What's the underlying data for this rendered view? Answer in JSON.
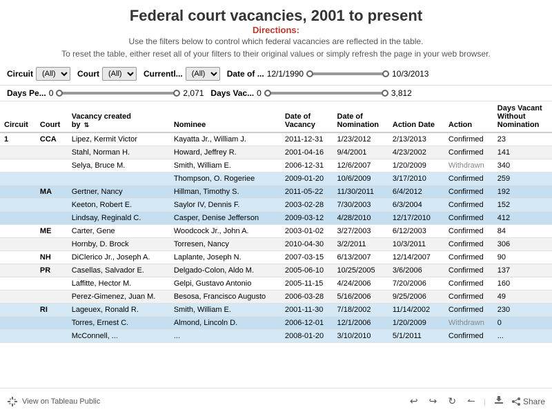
{
  "title": "Federal court vacancies, 2001 to present",
  "directions": {
    "label": "Directions:",
    "line1": "Use the filters below to control which federal vacancies are reflected in the table.",
    "line2": "To reset the table, either reset all of your filters to their original values or simply refresh the page in your web browser."
  },
  "filters": {
    "circuit_label": "Circuit",
    "circuit_value": "(All)",
    "court_label": "Court",
    "court_value": "(All)",
    "currently_label": "Currentl...",
    "currently_value": "(All)",
    "date_label": "Date of ...",
    "date_min": "12/1/1990",
    "date_max": "10/3/2013",
    "days_pending_label": "Days Pe...",
    "days_pending_min": "0",
    "days_pending_max": "2,071",
    "days_vacant_label": "Days Vac...",
    "days_vacant_min": "0",
    "days_vacant_max": "3,812"
  },
  "table": {
    "columns": [
      {
        "id": "circuit",
        "label": "Circuit"
      },
      {
        "id": "court",
        "label": "Court"
      },
      {
        "id": "vacancy_created_by",
        "label": "Vacancy created by"
      },
      {
        "id": "nominee",
        "label": "Nominee"
      },
      {
        "id": "date_of_vacancy",
        "label": "Date of Vacancy"
      },
      {
        "id": "date_of_nomination",
        "label": "Date of Nomination"
      },
      {
        "id": "action_date",
        "label": "Action Date"
      },
      {
        "id": "action",
        "label": "Action"
      },
      {
        "id": "days_vacant",
        "label": "Days Vacant Without Nomination"
      }
    ],
    "rows": [
      {
        "circuit": "1",
        "court": "CCA",
        "vacancy_created_by": "Lipez, Kermit Victor",
        "nominee": "Kayatta Jr., William J.",
        "date_of_vacancy": "2011-12-31",
        "date_of_nomination": "1/23/2012",
        "action_date": "2/13/2013",
        "action": "Confirmed",
        "days_vacant": "23",
        "style": "normal"
      },
      {
        "circuit": "",
        "court": "",
        "vacancy_created_by": "Stahl, Norman H.",
        "nominee": "Howard, Jeffrey R.",
        "date_of_vacancy": "2001-04-16",
        "date_of_nomination": "9/4/2001",
        "action_date": "4/23/2002",
        "action": "Confirmed",
        "days_vacant": "141",
        "style": "alt"
      },
      {
        "circuit": "",
        "court": "",
        "vacancy_created_by": "Selya, Bruce M.",
        "nominee": "Smith, William E.",
        "date_of_vacancy": "2006-12-31",
        "date_of_nomination": "12/6/2007",
        "action_date": "1/20/2009",
        "action": "Withdrawn",
        "days_vacant": "340",
        "style": "normal"
      },
      {
        "circuit": "",
        "court": "",
        "vacancy_created_by": "",
        "nominee": "Thompson, O. Rogeriee",
        "date_of_vacancy": "2009-01-20",
        "date_of_nomination": "10/6/2009",
        "action_date": "3/17/2010",
        "action": "Confirmed",
        "days_vacant": "259",
        "style": "blue"
      },
      {
        "circuit": "",
        "court": "MA",
        "vacancy_created_by": "Gertner, Nancy",
        "nominee": "Hillman, Timothy S.",
        "date_of_vacancy": "2011-05-22",
        "date_of_nomination": "11/30/2011",
        "action_date": "6/4/2012",
        "action": "Confirmed",
        "days_vacant": "192",
        "style": "blue-alt"
      },
      {
        "circuit": "",
        "court": "",
        "vacancy_created_by": "Keeton, Robert E.",
        "nominee": "Saylor IV, Dennis F.",
        "date_of_vacancy": "2003-02-28",
        "date_of_nomination": "7/30/2003",
        "action_date": "6/3/2004",
        "action": "Confirmed",
        "days_vacant": "152",
        "style": "blue"
      },
      {
        "circuit": "",
        "court": "",
        "vacancy_created_by": "Lindsay, Reginald C.",
        "nominee": "Casper, Denise Jefferson",
        "date_of_vacancy": "2009-03-12",
        "date_of_nomination": "4/28/2010",
        "action_date": "12/17/2010",
        "action": "Confirmed",
        "days_vacant": "412",
        "style": "blue-alt"
      },
      {
        "circuit": "",
        "court": "ME",
        "vacancy_created_by": "Carter, Gene",
        "nominee": "Woodcock Jr., John A.",
        "date_of_vacancy": "2003-01-02",
        "date_of_nomination": "3/27/2003",
        "action_date": "6/12/2003",
        "action": "Confirmed",
        "days_vacant": "84",
        "style": "normal"
      },
      {
        "circuit": "",
        "court": "",
        "vacancy_created_by": "Hornby, D. Brock",
        "nominee": "Torresen, Nancy",
        "date_of_vacancy": "2010-04-30",
        "date_of_nomination": "3/2/2011",
        "action_date": "10/3/2011",
        "action": "Confirmed",
        "days_vacant": "306",
        "style": "alt"
      },
      {
        "circuit": "",
        "court": "NH",
        "vacancy_created_by": "DiClerico Jr., Joseph A.",
        "nominee": "Laplante, Joseph N.",
        "date_of_vacancy": "2007-03-15",
        "date_of_nomination": "6/13/2007",
        "action_date": "12/14/2007",
        "action": "Confirmed",
        "days_vacant": "90",
        "style": "normal"
      },
      {
        "circuit": "",
        "court": "PR",
        "vacancy_created_by": "Casellas, Salvador E.",
        "nominee": "Delgado-Colon, Aldo M.",
        "date_of_vacancy": "2005-06-10",
        "date_of_nomination": "10/25/2005",
        "action_date": "3/6/2006",
        "action": "Confirmed",
        "days_vacant": "137",
        "style": "alt"
      },
      {
        "circuit": "",
        "court": "",
        "vacancy_created_by": "Laffitte, Hector M.",
        "nominee": "Gelpi, Gustavo Antonio",
        "date_of_vacancy": "2005-11-15",
        "date_of_nomination": "4/24/2006",
        "action_date": "7/20/2006",
        "action": "Confirmed",
        "days_vacant": "160",
        "style": "normal"
      },
      {
        "circuit": "",
        "court": "",
        "vacancy_created_by": "Perez-Gimenez, Juan M.",
        "nominee": "Besosa, Francisco Augusto",
        "date_of_vacancy": "2006-03-28",
        "date_of_nomination": "5/16/2006",
        "action_date": "9/25/2006",
        "action": "Confirmed",
        "days_vacant": "49",
        "style": "alt"
      },
      {
        "circuit": "",
        "court": "RI",
        "vacancy_created_by": "Lageuex, Ronald R.",
        "nominee": "Smith, William E.",
        "date_of_vacancy": "2001-11-30",
        "date_of_nomination": "7/18/2002",
        "action_date": "11/14/2002",
        "action": "Confirmed",
        "days_vacant": "230",
        "style": "blue"
      },
      {
        "circuit": "",
        "court": "",
        "vacancy_created_by": "Torres, Ernest C.",
        "nominee": "Almond, Lincoln D.",
        "date_of_vacancy": "2006-12-01",
        "date_of_nomination": "12/1/2006",
        "action_date": "1/20/2009",
        "action": "Withdrawn",
        "days_vacant": "0",
        "style": "blue-alt"
      },
      {
        "circuit": "",
        "court": "",
        "vacancy_created_by": "McConnell, ...",
        "nominee": "...",
        "date_of_vacancy": "2008-01-20",
        "date_of_nomination": "3/10/2010",
        "action_date": "5/1/2011",
        "action": "Confirmed",
        "days_vacant": "...",
        "style": "blue"
      }
    ]
  },
  "footer": {
    "tableau_label": "View on Tableau Public",
    "share_label": "Share",
    "nav_buttons": [
      "↩",
      "↪",
      "⟳",
      "⟲"
    ]
  }
}
